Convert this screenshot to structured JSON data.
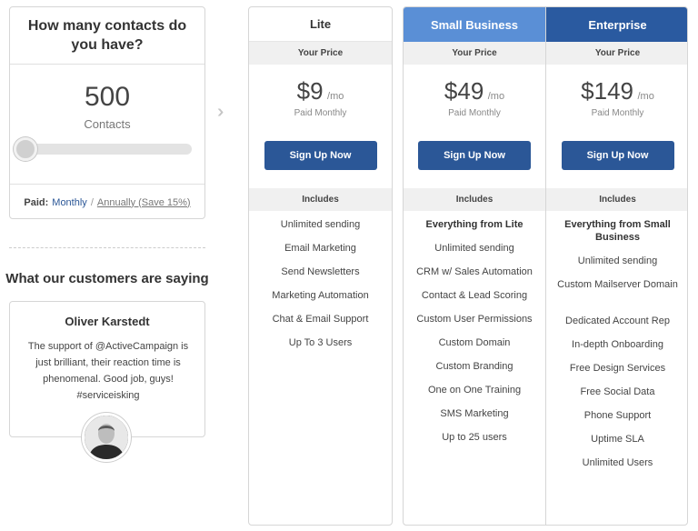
{
  "contacts": {
    "question": "How many contacts do you have?",
    "count": "500",
    "label": "Contacts",
    "slider_value": 500,
    "paid_label": "Paid:",
    "monthly": "Monthly",
    "separator": "/",
    "annually": "Annually (Save 15%)"
  },
  "customers": {
    "title": "What our customers are saying",
    "name": "Oliver Karstedt",
    "quote": "The support of @ActiveCampaign is just brilliant, their reaction time is phenomenal. Good job, guys! #serviceisking"
  },
  "arrow_icon": "double-chevron-right",
  "plans": [
    {
      "name": "Lite",
      "your_price": "Your Price",
      "price": "$9",
      "per": "/mo",
      "billing": "Paid Monthly",
      "button": "Sign Up Now",
      "includes": "Includes",
      "features": [
        "Unlimited sending",
        "Email Marketing",
        "Send Newsletters",
        "Marketing Automation",
        "Chat & Email Support",
        "Up To 3 Users"
      ]
    },
    {
      "name": "Small Business",
      "your_price": "Your Price",
      "price": "$49",
      "per": "/mo",
      "billing": "Paid Monthly",
      "button": "Sign Up Now",
      "includes": "Includes",
      "features": [
        "Everything from Lite",
        "Unlimited sending",
        "CRM w/ Sales Automation",
        "Contact & Lead Scoring",
        "Custom User Permissions",
        "Custom Domain",
        "Custom Branding",
        "One on One Training",
        "SMS Marketing",
        "Up to 25 users"
      ]
    },
    {
      "name": "Enterprise",
      "your_price": "Your Price",
      "price": "$149",
      "per": "/mo",
      "billing": "Paid Monthly",
      "button": "Sign Up Now",
      "includes": "Includes",
      "features": [
        "Everything from Small Business",
        "Unlimited sending",
        "Custom Mailserver Domain",
        "Dedicated Account Rep",
        "In-depth Onboarding",
        "Free Design Services",
        "Free Social Data",
        "Phone Support",
        "Uptime SLA",
        "Unlimited Users"
      ]
    }
  ],
  "colors": {
    "accent": "#2b5797",
    "small_business_header": "#5a8fd6",
    "enterprise_header": "#2a5aa0"
  }
}
